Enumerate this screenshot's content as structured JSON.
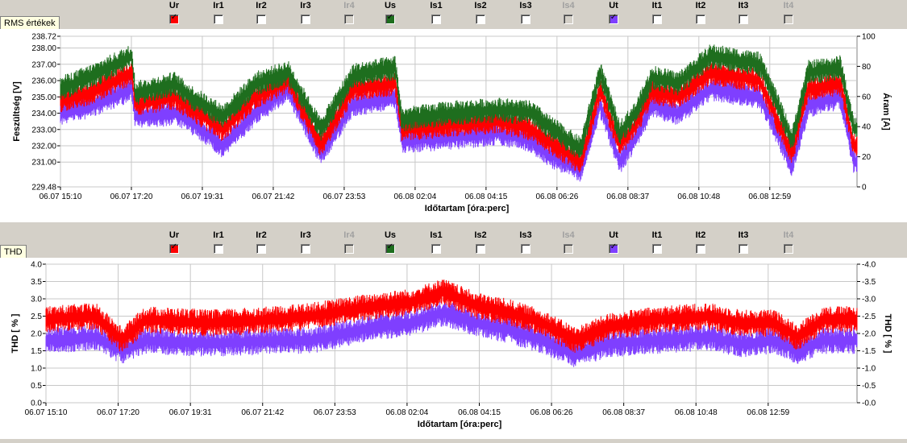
{
  "panels": [
    {
      "tag": "RMS értékek",
      "checkboxes": [
        {
          "label": "Ur",
          "checked": true,
          "color": "#ff0000",
          "disabled": false
        },
        {
          "label": "Ir1",
          "checked": false,
          "color": "",
          "disabled": false
        },
        {
          "label": "Ir2",
          "checked": false,
          "color": "",
          "disabled": false
        },
        {
          "label": "Ir3",
          "checked": false,
          "color": "",
          "disabled": false
        },
        {
          "label": "Ir4",
          "checked": false,
          "color": "",
          "disabled": true
        },
        {
          "label": "Us",
          "checked": true,
          "color": "#1e6e1e",
          "disabled": false
        },
        {
          "label": "Is1",
          "checked": false,
          "color": "",
          "disabled": false
        },
        {
          "label": "Is2",
          "checked": false,
          "color": "",
          "disabled": false
        },
        {
          "label": "Is3",
          "checked": false,
          "color": "",
          "disabled": false
        },
        {
          "label": "Is4",
          "checked": false,
          "color": "",
          "disabled": true
        },
        {
          "label": "Ut",
          "checked": true,
          "color": "#7f3fff",
          "disabled": false
        },
        {
          "label": "It1",
          "checked": false,
          "color": "",
          "disabled": false
        },
        {
          "label": "It2",
          "checked": false,
          "color": "",
          "disabled": false
        },
        {
          "label": "It3",
          "checked": false,
          "color": "",
          "disabled": false
        },
        {
          "label": "It4",
          "checked": false,
          "color": "",
          "disabled": true
        }
      ]
    },
    {
      "tag": "THD",
      "checkboxes": [
        {
          "label": "Ur",
          "checked": true,
          "color": "#ff0000",
          "disabled": false
        },
        {
          "label": "Ir1",
          "checked": false,
          "color": "",
          "disabled": false
        },
        {
          "label": "Ir2",
          "checked": false,
          "color": "",
          "disabled": false
        },
        {
          "label": "Ir3",
          "checked": false,
          "color": "",
          "disabled": false
        },
        {
          "label": "Ir4",
          "checked": false,
          "color": "",
          "disabled": true
        },
        {
          "label": "Us",
          "checked": true,
          "color": "#1e6e1e",
          "disabled": false
        },
        {
          "label": "Is1",
          "checked": false,
          "color": "",
          "disabled": false
        },
        {
          "label": "Is2",
          "checked": false,
          "color": "",
          "disabled": false
        },
        {
          "label": "Is3",
          "checked": false,
          "color": "",
          "disabled": false
        },
        {
          "label": "Is4",
          "checked": false,
          "color": "",
          "disabled": true
        },
        {
          "label": "Ut",
          "checked": true,
          "color": "#7f3fff",
          "disabled": false
        },
        {
          "label": "It1",
          "checked": false,
          "color": "",
          "disabled": false
        },
        {
          "label": "It2",
          "checked": false,
          "color": "",
          "disabled": false
        },
        {
          "label": "It3",
          "checked": false,
          "color": "",
          "disabled": false
        },
        {
          "label": "It4",
          "checked": false,
          "color": "",
          "disabled": true
        }
      ]
    }
  ],
  "chart_data": [
    {
      "type": "line",
      "xlabel": "Időtartam [óra:perc]",
      "ylabel": "Feszültség [V]",
      "y2label": "Áram [A]",
      "x_ticks": [
        "06.07 15:10",
        "06.07 17:20",
        "06.07 19:31",
        "06.07 21:42",
        "06.07 23:53",
        "06.08 02:04",
        "06.08 04:15",
        "06.08 06:26",
        "06.08 08:37",
        "06.08 10:48",
        "06.08 12:59"
      ],
      "x_range_hours": [
        0,
        24.5
      ],
      "ylim": [
        229.48,
        238.72
      ],
      "y_ticks": [
        "229.48",
        "231.00",
        "232.00",
        "233.00",
        "234.00",
        "235.00",
        "236.00",
        "237.00",
        "238.00",
        "238.72"
      ],
      "y2lim": [
        0,
        100
      ],
      "y2_ticks": [
        "0",
        "20",
        "40",
        "60",
        "80",
        "100"
      ],
      "grid": true,
      "series": [
        {
          "name": "Ut",
          "color": "#7f3fff",
          "points": [
            [
              0,
              234.0
            ],
            [
              1.0,
              234.5
            ],
            [
              2.2,
              235.5
            ],
            [
              2.3,
              233.8
            ],
            [
              3.5,
              234.0
            ],
            [
              4.0,
              233.5
            ],
            [
              5.0,
              232.0
            ],
            [
              6.0,
              234.0
            ],
            [
              7.0,
              235.5
            ],
            [
              8.0,
              231.5
            ],
            [
              9.0,
              234.5
            ],
            [
              10.3,
              235.0
            ],
            [
              10.5,
              232.3
            ],
            [
              12.0,
              232.5
            ],
            [
              13.5,
              232.8
            ],
            [
              14.5,
              232.3
            ],
            [
              15.0,
              231.5
            ],
            [
              16.0,
              230.5
            ],
            [
              16.6,
              234.5
            ],
            [
              17.2,
              231.0
            ],
            [
              17.7,
              232.5
            ],
            [
              18.2,
              234.5
            ],
            [
              19.0,
              234.0
            ],
            [
              20.0,
              235.5
            ],
            [
              21.5,
              235.0
            ],
            [
              22.0,
              233.0
            ],
            [
              22.5,
              230.8
            ],
            [
              23.0,
              234.5
            ],
            [
              24.0,
              235.0
            ],
            [
              24.4,
              231.0
            ]
          ]
        },
        {
          "name": "Ur",
          "color": "#ff0000",
          "points": [
            [
              0,
              234.8
            ],
            [
              1.0,
              235.3
            ],
            [
              2.2,
              236.5
            ],
            [
              2.3,
              234.5
            ],
            [
              3.5,
              235.0
            ],
            [
              4.0,
              234.3
            ],
            [
              5.0,
              233.0
            ],
            [
              6.0,
              235.0
            ],
            [
              7.0,
              236.0
            ],
            [
              8.0,
              232.0
            ],
            [
              9.0,
              235.5
            ],
            [
              10.3,
              235.8
            ],
            [
              10.5,
              233.0
            ],
            [
              12.0,
              233.3
            ],
            [
              13.5,
              233.5
            ],
            [
              14.5,
              233.0
            ],
            [
              15.0,
              232.3
            ],
            [
              16.0,
              231.0
            ],
            [
              16.6,
              235.5
            ],
            [
              17.2,
              232.0
            ],
            [
              17.7,
              233.3
            ],
            [
              18.2,
              235.3
            ],
            [
              19.0,
              235.0
            ],
            [
              20.0,
              236.5
            ],
            [
              21.5,
              236.0
            ],
            [
              22.0,
              233.8
            ],
            [
              22.5,
              231.5
            ],
            [
              23.0,
              235.5
            ],
            [
              24.0,
              235.8
            ],
            [
              24.4,
              232.0
            ]
          ]
        },
        {
          "name": "Us",
          "color": "#1e6e1e",
          "points": [
            [
              0,
              235.5
            ],
            [
              1.0,
              236.3
            ],
            [
              2.2,
              237.5
            ],
            [
              2.3,
              235.2
            ],
            [
              3.5,
              235.8
            ],
            [
              4.0,
              235.0
            ],
            [
              5.0,
              233.8
            ],
            [
              6.0,
              235.8
            ],
            [
              7.0,
              236.5
            ],
            [
              8.0,
              233.0
            ],
            [
              9.0,
              236.3
            ],
            [
              10.3,
              236.8
            ],
            [
              10.5,
              233.6
            ],
            [
              12.0,
              234.0
            ],
            [
              13.5,
              234.2
            ],
            [
              14.5,
              234.0
            ],
            [
              15.0,
              233.2
            ],
            [
              16.0,
              231.8
            ],
            [
              16.6,
              236.5
            ],
            [
              17.2,
              232.8
            ],
            [
              17.7,
              234.0
            ],
            [
              18.2,
              236.2
            ],
            [
              19.0,
              235.8
            ],
            [
              20.0,
              237.5
            ],
            [
              21.5,
              237.0
            ],
            [
              22.0,
              234.8
            ],
            [
              22.5,
              232.3
            ],
            [
              23.0,
              236.5
            ],
            [
              24.0,
              236.8
            ],
            [
              24.4,
              233.0
            ]
          ]
        }
      ]
    },
    {
      "type": "line",
      "xlabel": "Időtartam [óra:perc]",
      "ylabel": "THD [ % ]",
      "y2label": "THD [ % ]",
      "x_ticks": [
        "06.07 15:10",
        "06.07 17:20",
        "06.07 19:31",
        "06.07 21:42",
        "06.07 23:53",
        "06.08 02:04",
        "06.08 04:15",
        "06.08 06:26",
        "06.08 08:37",
        "06.08 10:48",
        "06.08 12:59"
      ],
      "x_range_hours": [
        0,
        24.5
      ],
      "ylim": [
        0,
        4
      ],
      "y_ticks": [
        "0.0",
        "0.5",
        "1.0",
        "1.5",
        "2.0",
        "2.5",
        "3.0",
        "3.5",
        "4.0"
      ],
      "y2_ticks": [
        "-0.0",
        "-0.5",
        "-1.0",
        "-1.5",
        "-2.0",
        "-2.5",
        "-3.0",
        "-3.5",
        "-4.0"
      ],
      "grid": true,
      "series": [
        {
          "name": "Ut",
          "color": "#7f3fff",
          "points": [
            [
              0,
              1.8
            ],
            [
              1.5,
              1.9
            ],
            [
              2.3,
              1.5
            ],
            [
              3.0,
              1.8
            ],
            [
              5.0,
              1.7
            ],
            [
              7.0,
              1.8
            ],
            [
              8.0,
              1.8
            ],
            [
              10.0,
              2.2
            ],
            [
              11.0,
              2.3
            ],
            [
              12.0,
              2.6
            ],
            [
              13.0,
              2.3
            ],
            [
              14.0,
              2.1
            ],
            [
              15.0,
              1.8
            ],
            [
              16.0,
              1.4
            ],
            [
              17.0,
              1.7
            ],
            [
              18.5,
              1.8
            ],
            [
              20.0,
              1.9
            ],
            [
              21.0,
              1.7
            ],
            [
              22.0,
              1.8
            ],
            [
              22.7,
              1.5
            ],
            [
              23.5,
              1.8
            ],
            [
              24.4,
              1.8
            ]
          ]
        },
        {
          "name": "Ur",
          "color": "#ff0000",
          "points": [
            [
              0,
              2.4
            ],
            [
              1.5,
              2.5
            ],
            [
              2.3,
              1.8
            ],
            [
              3.0,
              2.4
            ],
            [
              5.0,
              2.3
            ],
            [
              7.0,
              2.4
            ],
            [
              8.0,
              2.5
            ],
            [
              10.0,
              2.8
            ],
            [
              11.0,
              2.9
            ],
            [
              12.0,
              3.2
            ],
            [
              13.0,
              2.8
            ],
            [
              14.0,
              2.6
            ],
            [
              15.0,
              2.3
            ],
            [
              16.0,
              1.8
            ],
            [
              17.0,
              2.2
            ],
            [
              18.5,
              2.4
            ],
            [
              20.0,
              2.5
            ],
            [
              21.0,
              2.3
            ],
            [
              22.0,
              2.3
            ],
            [
              22.7,
              1.9
            ],
            [
              23.5,
              2.4
            ],
            [
              24.4,
              2.4
            ]
          ]
        }
      ]
    }
  ]
}
